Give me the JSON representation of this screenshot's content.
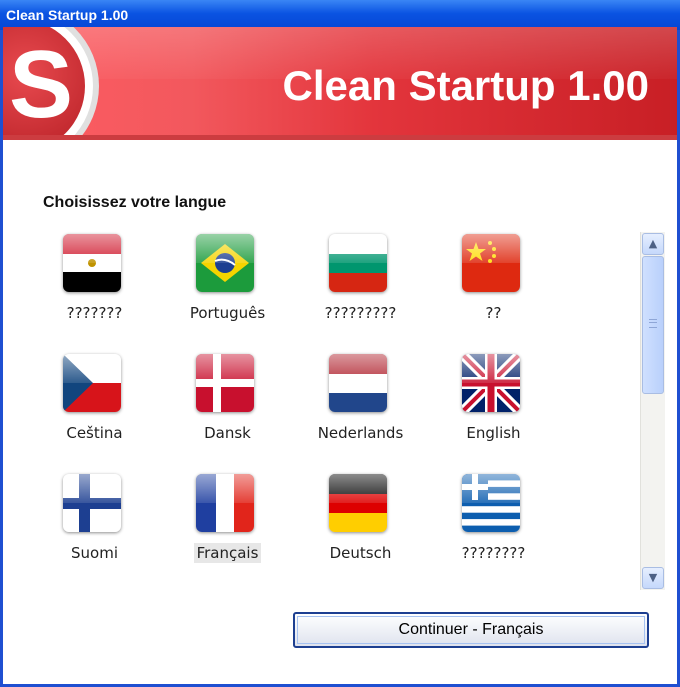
{
  "window": {
    "title": "Clean Startup 1.00"
  },
  "banner": {
    "title": "Clean Startup 1.00",
    "logo_letter": "S"
  },
  "heading": "Choisissez votre langue",
  "languages": [
    {
      "label": "???????",
      "flag": "egypt-flag-icon"
    },
    {
      "label": "Português",
      "flag": "brazil-flag-icon"
    },
    {
      "label": "?????????",
      "flag": "bulgaria-flag-icon"
    },
    {
      "label": "??",
      "flag": "china-flag-icon"
    },
    {
      "label": "Ceština",
      "flag": "czech-flag-icon"
    },
    {
      "label": "Dansk",
      "flag": "denmark-flag-icon"
    },
    {
      "label": "Nederlands",
      "flag": "netherlands-flag-icon"
    },
    {
      "label": "English",
      "flag": "uk-flag-icon"
    },
    {
      "label": "Suomi",
      "flag": "finland-flag-icon"
    },
    {
      "label": "Français",
      "flag": "france-flag-icon",
      "selected": true
    },
    {
      "label": "Deutsch",
      "flag": "germany-flag-icon"
    },
    {
      "label": "????????",
      "flag": "greece-flag-icon"
    }
  ],
  "scrollbar": {
    "up_icon": "▲",
    "down_icon": "▼"
  },
  "continue_button": "Continuer - Français",
  "colors": {
    "titlebar": "#0a53e2",
    "banner_left": "#ff5d63",
    "banner_right": "#c81f25",
    "button_border": "#1d3f91"
  }
}
